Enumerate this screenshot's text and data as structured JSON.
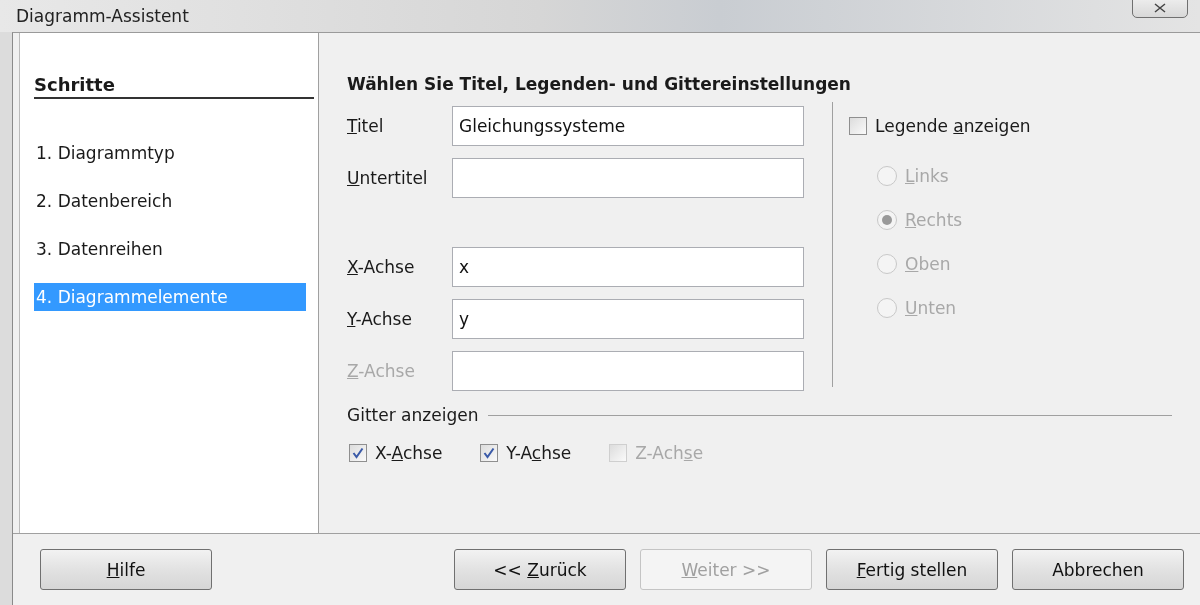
{
  "window": {
    "title": "Diagramm-Assistent"
  },
  "steps": {
    "heading": "Schritte",
    "items": [
      {
        "number": "1.",
        "label": "Diagrammtyp",
        "selected": false
      },
      {
        "number": "2.",
        "label": "Datenbereich",
        "selected": false
      },
      {
        "number": "3.",
        "label": "Datenreihen",
        "selected": false
      },
      {
        "number": "4.",
        "label": "Diagrammelemente",
        "selected": true
      }
    ]
  },
  "page": {
    "heading": "Wählen Sie Titel, Legenden- und Gittereinstellungen",
    "title_fields": [
      {
        "label": {
          "key": "T",
          "post": "itel"
        },
        "value": "Gleichungssysteme",
        "disabled": false
      },
      {
        "label": {
          "key": "U",
          "post": "ntertitel"
        },
        "disabled": false
      }
    ],
    "axis_fields": [
      {
        "label": {
          "key": "X",
          "post": "-Achse"
        },
        "value": "x",
        "disabled": false
      },
      {
        "label": {
          "key": "Y",
          "post": "-Achse"
        },
        "value": "y",
        "disabled": false
      },
      {
        "label": {
          "key": "Z",
          "post": "-Achse"
        },
        "disabled": true
      }
    ],
    "legend": {
      "label": {
        "pre": "Legende ",
        "key": "a",
        "post": "nzeigen"
      },
      "checked": false,
      "positions": [
        {
          "label": {
            "key": "L",
            "post": "inks"
          },
          "selected": false,
          "disabled": true
        },
        {
          "label": {
            "key": "R",
            "post": "echts"
          },
          "selected": true,
          "disabled": true
        },
        {
          "label": {
            "key": "O",
            "post": "ben"
          },
          "selected": false,
          "disabled": true
        },
        {
          "label": {
            "key": "U",
            "post": "nten"
          },
          "selected": false,
          "disabled": true
        }
      ]
    },
    "grid": {
      "heading": "Gitter anzeigen",
      "axes": [
        {
          "label": {
            "pre": "X-",
            "key": "A",
            "post": "chse"
          },
          "checked": true,
          "disabled": false
        },
        {
          "label": {
            "pre": "Y-A",
            "key": "c",
            "post": "hse"
          },
          "checked": true,
          "disabled": false
        },
        {
          "label": {
            "pre": "Z-Ach",
            "key": "s",
            "post": "e"
          },
          "checked": false,
          "disabled": true
        }
      ]
    }
  },
  "help_button": {
    "label": {
      "key": "H",
      "post": "ilfe"
    }
  },
  "nav_buttons": [
    {
      "label": {
        "pre": "<< ",
        "key": "Z",
        "post": "urück"
      },
      "disabled": false
    },
    {
      "label": {
        "key": "W",
        "post": "eiter >>"
      },
      "disabled": true
    },
    {
      "label": {
        "key": "F",
        "post": "ertig stellen"
      },
      "disabled": false
    },
    {
      "label": {
        "pre": "Abbrechen"
      },
      "disabled": false
    }
  ]
}
